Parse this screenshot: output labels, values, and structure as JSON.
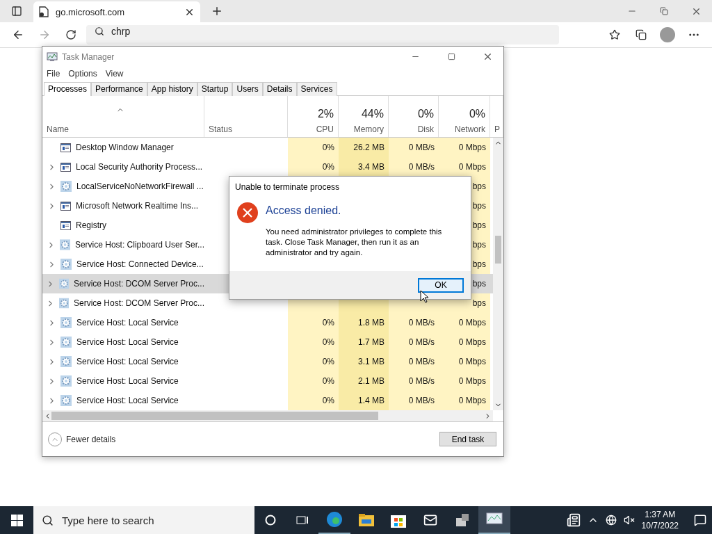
{
  "browser": {
    "tab": {
      "title": "go.microsoft.com"
    },
    "address": {
      "value": "chrp"
    }
  },
  "task_manager": {
    "title": "Task Manager",
    "menu": [
      "File",
      "Options",
      "View"
    ],
    "tabs": [
      {
        "label": "Processes",
        "selected": true
      },
      {
        "label": "Performance",
        "selected": false
      },
      {
        "label": "App history",
        "selected": false
      },
      {
        "label": "Startup",
        "selected": false
      },
      {
        "label": "Users",
        "selected": false
      },
      {
        "label": "Details",
        "selected": false
      },
      {
        "label": "Services",
        "selected": false
      }
    ],
    "columns": {
      "name": "Name",
      "status": "Status",
      "metrics": [
        {
          "percent": "2%",
          "label": "CPU",
          "kind": "light"
        },
        {
          "percent": "44%",
          "label": "Memory",
          "kind": "dark"
        },
        {
          "percent": "0%",
          "label": "Disk",
          "kind": "light"
        },
        {
          "percent": "0%",
          "label": "Network",
          "kind": "light"
        }
      ],
      "cut": "P"
    },
    "rows": [
      {
        "name": "Desktop Window Manager",
        "kind": "window",
        "expandable": false,
        "selected": false,
        "values": {
          "cpu": "0%",
          "memory": "26.2 MB",
          "disk": "0 MB/s",
          "network": "0 Mbps"
        }
      },
      {
        "name": "Local Security Authority Process...",
        "kind": "window",
        "expandable": true,
        "selected": false,
        "values": {
          "cpu": "0%",
          "memory": "3.4 MB",
          "disk": "0 MB/s",
          "network": "0 Mbps"
        }
      },
      {
        "name": "LocalServiceNoNetworkFirewall ...",
        "kind": "gear",
        "expandable": true,
        "selected": false,
        "values": {
          "network": "bps"
        }
      },
      {
        "name": "Microsoft Network Realtime Ins...",
        "kind": "window",
        "expandable": true,
        "selected": false,
        "values": {
          "network": "bps"
        }
      },
      {
        "name": "Registry",
        "kind": "window",
        "expandable": false,
        "selected": false,
        "values": {
          "network": "bps"
        }
      },
      {
        "name": "Service Host: Clipboard User Ser...",
        "kind": "gear",
        "expandable": true,
        "selected": false,
        "values": {
          "network": "bps"
        }
      },
      {
        "name": "Service Host: Connected Device...",
        "kind": "gear",
        "expandable": true,
        "selected": false,
        "values": {
          "network": "bps"
        }
      },
      {
        "name": "Service Host: DCOM Server Proc...",
        "kind": "gear",
        "expandable": true,
        "selected": true,
        "values": {
          "network": "bps"
        }
      },
      {
        "name": "Service Host: DCOM Server Proc...",
        "kind": "gear",
        "expandable": true,
        "selected": false,
        "values": {
          "network": "bps"
        }
      },
      {
        "name": "Service Host: Local Service",
        "kind": "gear",
        "expandable": true,
        "selected": false,
        "values": {
          "cpu": "0%",
          "memory": "1.8 MB",
          "disk": "0 MB/s",
          "network": "0 Mbps"
        }
      },
      {
        "name": "Service Host: Local Service",
        "kind": "gear",
        "expandable": true,
        "selected": false,
        "values": {
          "cpu": "0%",
          "memory": "1.7 MB",
          "disk": "0 MB/s",
          "network": "0 Mbps"
        }
      },
      {
        "name": "Service Host: Local Service",
        "kind": "gear",
        "expandable": true,
        "selected": false,
        "values": {
          "cpu": "0%",
          "memory": "3.1 MB",
          "disk": "0 MB/s",
          "network": "0 Mbps"
        }
      },
      {
        "name": "Service Host: Local Service",
        "kind": "gear",
        "expandable": true,
        "selected": false,
        "values": {
          "cpu": "0%",
          "memory": "2.1 MB",
          "disk": "0 MB/s",
          "network": "0 Mbps"
        }
      },
      {
        "name": "Service Host: Local Service",
        "kind": "gear",
        "expandable": true,
        "selected": false,
        "values": {
          "cpu": "0%",
          "memory": "1.4 MB",
          "disk": "0 MB/s",
          "network": "0 Mbps"
        }
      }
    ],
    "footer": {
      "toggle": "Fewer details",
      "end_task": "End task"
    }
  },
  "dialog": {
    "title": "Unable to terminate process",
    "heading": "Access denied.",
    "message": "You need administrator privileges to complete this task. Close Task Manager, then run it as an administrator and try again.",
    "button": "OK"
  },
  "taskbar": {
    "search": {
      "placeholder": "Type here to search"
    },
    "time": "1:37 AM",
    "date": "10/7/2022"
  }
}
